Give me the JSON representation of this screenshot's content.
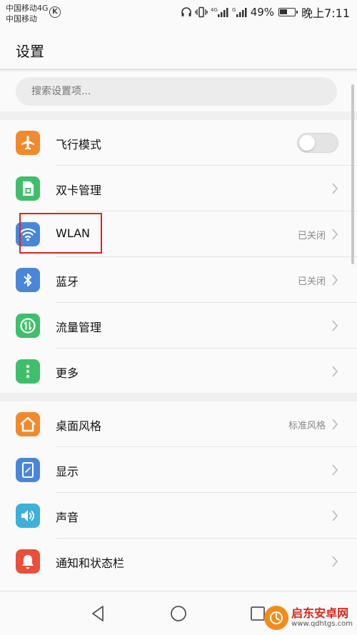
{
  "status_bar": {
    "carrier_1": "中国移动4G",
    "carrier_2": "中国移动",
    "k_badge": "K",
    "battery_percent": "49%",
    "time": "晚上7:11",
    "icons": [
      "headset-icon",
      "vibrate-icon",
      "signal-4g-icon",
      "signal-g-icon",
      "battery-icon"
    ]
  },
  "header": {
    "title": "设置"
  },
  "search": {
    "placeholder": "搜索设置项..."
  },
  "groups": [
    {
      "items": [
        {
          "label": "飞行模式",
          "icon": "airplane-icon",
          "color": "#f08a2c",
          "control": "toggle",
          "toggle_on": false
        },
        {
          "label": "双卡管理",
          "icon": "sim-card-icon",
          "color": "#3fbf6b",
          "control": "chevron"
        },
        {
          "label": "WLAN",
          "icon": "wifi-icon",
          "color": "#4a86d8",
          "value": "已关闭",
          "control": "chevron"
        },
        {
          "label": "蓝牙",
          "icon": "bluetooth-icon",
          "color": "#4a86d8",
          "value": "已关闭",
          "control": "chevron"
        },
        {
          "label": "流量管理",
          "icon": "data-usage-icon",
          "color": "#3fbf6b",
          "control": "chevron"
        },
        {
          "label": "更多",
          "icon": "more-icon",
          "color": "#3fbf6b",
          "control": "chevron"
        }
      ]
    },
    {
      "items": [
        {
          "label": "桌面风格",
          "icon": "home-style-icon",
          "color": "#f08a2c",
          "value": "标准风格",
          "control": "chevron"
        },
        {
          "label": "显示",
          "icon": "display-icon",
          "color": "#4a86d8",
          "control": "chevron"
        },
        {
          "label": "声音",
          "icon": "sound-icon",
          "color": "#3fb0d8",
          "control": "chevron"
        },
        {
          "label": "通知和状态栏",
          "icon": "notification-bell-icon",
          "color": "#e8503a",
          "control": "chevron"
        }
      ]
    }
  ],
  "watermark": {
    "title": "启东安卓网",
    "url": "www.qdhtgs.com"
  },
  "colors": {
    "highlight": "#d9261c",
    "background": "#f0f0f0",
    "surface": "#fafafa"
  }
}
